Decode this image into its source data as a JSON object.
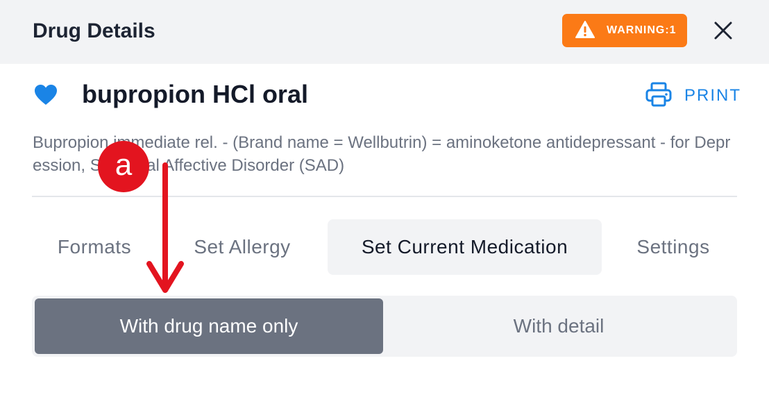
{
  "header": {
    "title": "Drug Details",
    "warning_label": "WARNING:1",
    "warning_color": "#fb7a16",
    "close_icon": "close-icon"
  },
  "drug": {
    "name": "bupropion HCl oral",
    "favorite_icon": "heart-icon",
    "description": "Bupropion immediate rel. - (Brand name = Wellbutrin) = aminoketone antidepressant - for Depression, Seasonal Affective Disorder (SAD)"
  },
  "print": {
    "label": "PRINT",
    "icon": "printer-icon",
    "color": "#1a84e6"
  },
  "tabs": [
    {
      "label": "Formats",
      "active": false
    },
    {
      "label": "Set Allergy",
      "active": false
    },
    {
      "label": "Set Current Medication",
      "active": true
    },
    {
      "label": "Settings",
      "active": false
    }
  ],
  "segment": {
    "options": [
      {
        "label": "With drug name only",
        "selected": true
      },
      {
        "label": "With detail",
        "selected": false
      }
    ]
  },
  "annotation": {
    "badge_label": "a",
    "color": "#e3141f"
  }
}
